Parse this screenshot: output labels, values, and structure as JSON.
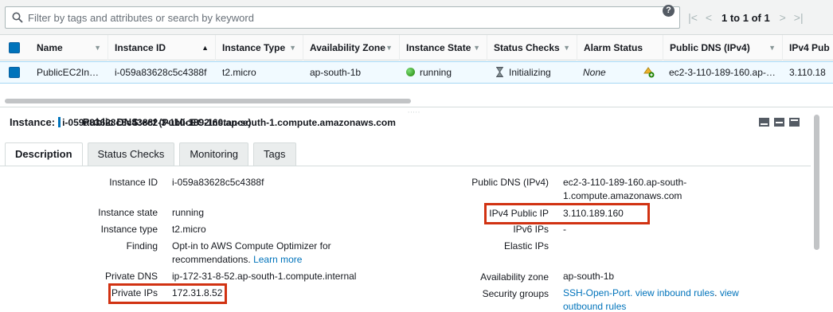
{
  "filter": {
    "placeholder": "Filter by tags and attributes or search by keyword",
    "help_icon": "?",
    "pagination": "1 to 1 of 1"
  },
  "table": {
    "columns": [
      "Name",
      "Instance ID",
      "Instance Type",
      "Availability Zone",
      "Instance State",
      "Status Checks",
      "Alarm Status",
      "Public DNS (IPv4)",
      "IPv4 Pub"
    ],
    "row": {
      "name": "PublicEC2In…",
      "instance_id": "i-059a83628c5c4388f",
      "instance_type": "t2.micro",
      "availability_zone": "ap-south-1b",
      "instance_state": "running",
      "status_checks": "Initializing",
      "alarm_status": "None",
      "public_dns": "ec2-3-110-189-160.ap-…",
      "ipv4_public": "3.110.18"
    }
  },
  "details": {
    "instance_label": "Instance:",
    "instance_value": "i-059a83628c5c4388f (PublicEC2Instance)",
    "dns_label": "Public DNS:",
    "dns_value": "ec2-3-110-189-160.ap-south-1.compute.amazonaws.com",
    "tabs": [
      "Description",
      "Status Checks",
      "Monitoring",
      "Tags"
    ],
    "left": {
      "instance_id_label": "Instance ID",
      "instance_id": "i-059a83628c5c4388f",
      "instance_state_label": "Instance state",
      "instance_state": "running",
      "instance_type_label": "Instance type",
      "instance_type": "t2.micro",
      "finding_label": "Finding",
      "finding_line1": "Opt-in to AWS Compute Optimizer for",
      "finding_line2": "recommendations.",
      "finding_link": "Learn more",
      "private_dns_label": "Private DNS",
      "private_dns": "ip-172-31-8-52.ap-south-1.compute.internal",
      "private_ips_label": "Private IPs",
      "private_ips": "172.31.8.52"
    },
    "right": {
      "public_dns_label": "Public DNS (IPv4)",
      "public_dns_line1": "ec2-3-110-189-160.ap-south-",
      "public_dns_line2": "1.compute.amazonaws.com",
      "ipv4_public_ip_label": "IPv4 Public IP",
      "ipv4_public_ip": "3.110.189.160",
      "ipv6_ips_label": "IPv6 IPs",
      "ipv6_ips": "-",
      "elastic_ips_label": "Elastic IPs",
      "availability_zone_label": "Availability zone",
      "availability_zone": "ap-south-1b",
      "security_groups_label": "Security groups",
      "sg_link1": "SSH-Open-Port.",
      "sg_link2": "view inbound rules",
      "sg_sep": ".",
      "sg_link3": "view",
      "sg_link4": "outbound rules"
    }
  },
  "colors": {
    "accent": "#0073bb",
    "highlight_box": "#d13212",
    "running": "#1d8102"
  }
}
